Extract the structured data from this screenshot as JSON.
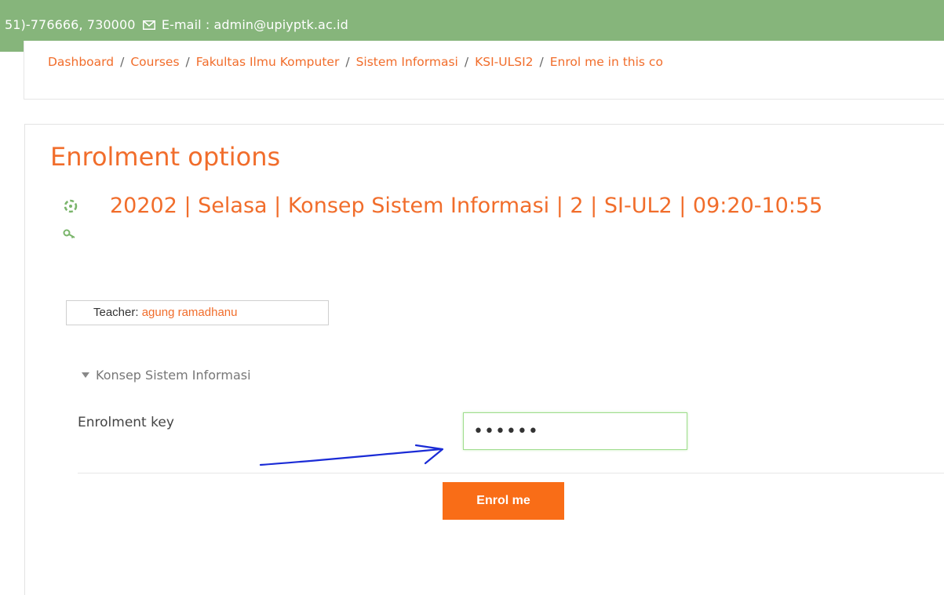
{
  "header": {
    "phone_text": "51)-776666, 730000",
    "email_text": "E-mail : admin@upiyptk.ac.id",
    "bar_color": "#86b57b"
  },
  "breadcrumb": {
    "items": [
      "Dashboard",
      "Courses",
      "Fakultas Ilmu Komputer",
      "Sistem Informasi",
      "KSI-ULSI2",
      "Enrol me in this co"
    ],
    "separator": "/"
  },
  "main": {
    "title": "Enrolment options",
    "course_name": "20202 | Selasa | Konsep Sistem Informasi | 2 | SI-UL2 | 09:20-10:55",
    "teacher_label": "Teacher",
    "teacher_name": "agung ramadhanu",
    "section_title": "Konsep Sistem Informasi",
    "key_label": "Enrolment key",
    "key_value": "••••••",
    "enrol_button": "Enrol me",
    "accent_color": "#f16d2b"
  }
}
